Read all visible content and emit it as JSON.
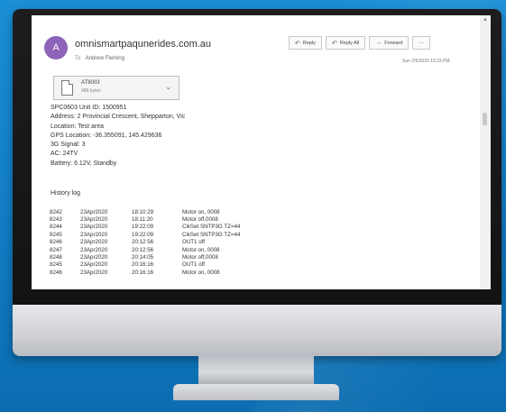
{
  "email": {
    "avatar_letter": "A",
    "from": "omnismartpaqunerides.com.au",
    "to_label": "To",
    "to": "Andrew Fleming",
    "date": "Sun 2/5/2020 10:23 PM",
    "actions": {
      "reply": "Reply",
      "reply_all": "Reply All",
      "forward": "Forward",
      "more": "···"
    },
    "attachment": {
      "name": "AT8003",
      "size": "488 bytes"
    },
    "body_lines": [
      "SPC0603 Unit ID: 1500951",
      "Address: 2 Provincial Crescent, Shepparton, Vic",
      "Location: Test area",
      "GPS Location: -36.355091, 145.429636",
      "3G Signal: 3",
      "AC: 24TV",
      "Battery: 6.12V, Standby"
    ],
    "history_title": "History log",
    "log": [
      [
        "8242",
        "23Apr2020",
        "18:10:29",
        "Motor on, 0008"
      ],
      [
        "8243",
        "23Apr2020",
        "18:11:20",
        "Motor off,0008"
      ],
      [
        "8244",
        "23Apr2020",
        "19:22:09",
        "CikSet SNTP3G TZ=44"
      ],
      [
        "8245",
        "23Apr2020",
        "19:22:09",
        "CikSet SNTP3G TZ=44"
      ],
      [
        "8246",
        "23Apr2020",
        "20:12:56",
        "OUT1 off"
      ],
      [
        "8247",
        "23Apr2020",
        "20:12:56",
        "Motor on, 0008"
      ],
      [
        "8248",
        "23Apr2020",
        "20:14:05",
        "Motor off,0008"
      ],
      [
        "8245",
        "23Apr2020",
        "20:16:16",
        "OUT1 off"
      ],
      [
        "8246",
        "23Apr2020",
        "20:16:16",
        "Motor on, 0008"
      ]
    ]
  }
}
